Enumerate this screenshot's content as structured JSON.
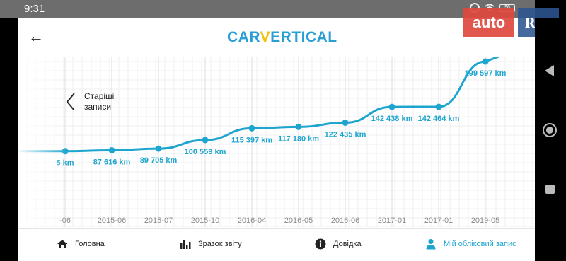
{
  "status": {
    "time": "9:31",
    "battery": "96"
  },
  "header": {
    "logo_pre": "CAR",
    "logo_v": "V",
    "logo_post": "ERTICAL"
  },
  "older": {
    "label": "Старіші записи"
  },
  "nav": [
    {
      "label": "Головна",
      "icon": "home-icon"
    },
    {
      "label": "Зразок звіту",
      "icon": "bar-chart-icon"
    },
    {
      "label": "Довідка",
      "icon": "info-icon"
    },
    {
      "label": "Мій обліковий запис",
      "icon": "user-icon"
    }
  ],
  "watermark": {
    "auto": "auto",
    "ria": "RIA"
  },
  "colors": {
    "accent": "#1ea5cf",
    "logo_blue": "#2a9fd6",
    "logo_yellow": "#f1c40f"
  },
  "chart_data": {
    "type": "line",
    "xlabel": "",
    "ylabel": "",
    "categories": [
      "-06",
      "2015-06",
      "2015-07",
      "2015-10",
      "2016-04",
      "2016-05",
      "2016-06",
      "2017-01",
      "2017-01",
      "2019-05"
    ],
    "values": [
      86500,
      87616,
      89705,
      100559,
      115397,
      117180,
      122435,
      142438,
      142464,
      199597
    ],
    "point_labels": [
      "5 km",
      "87 616 km",
      "89 705 km",
      "100 559 km",
      "115 397 km",
      "117 180 km",
      "122 435 km",
      "142 438 km",
      "142 464 km",
      "199 597 km"
    ],
    "grid": true
  }
}
